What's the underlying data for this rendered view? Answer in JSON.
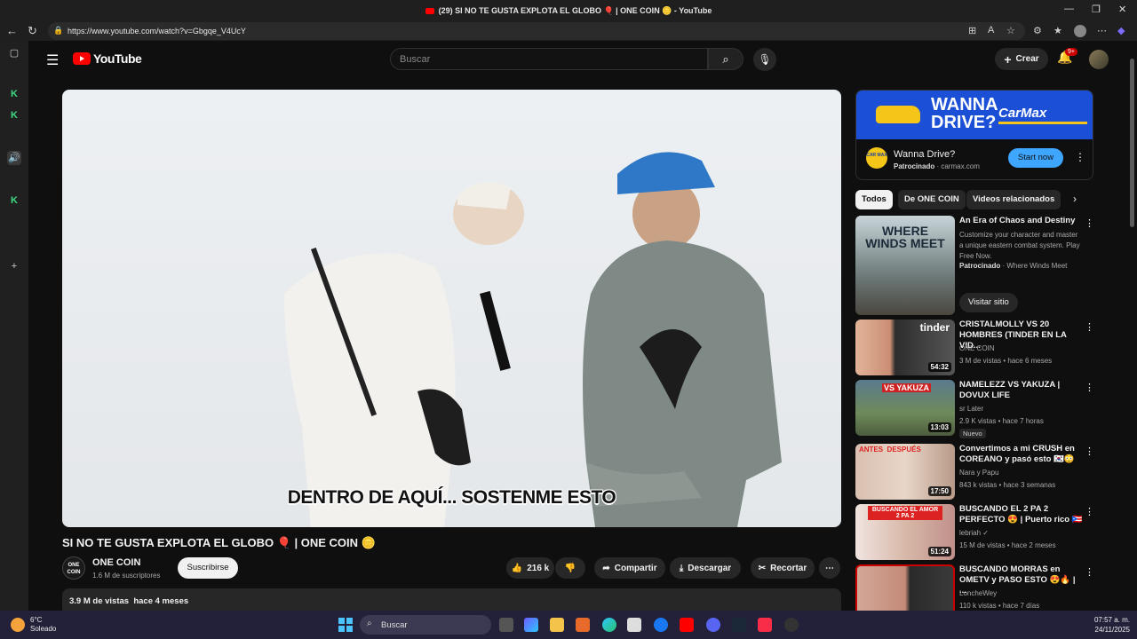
{
  "browser": {
    "window_title": "(29) SI NO TE GUSTA EXPLOTA EL GLOBO 🎈 | ONE COIN 🪙 - YouTube",
    "url": "https://www.youtube.com/watch?v=Gbgqe_V4UcY"
  },
  "youtube": {
    "logo_text": "YouTube",
    "search_placeholder": "Buscar",
    "create_label": "Crear",
    "notif_count": "9+"
  },
  "video": {
    "subtitle": "DENTRO DE AQUÍ... SOSTENME ESTO",
    "title": "SI NO TE GUSTA EXPLOTA EL GLOBO 🎈 | ONE COIN 🪙",
    "channel_avatar_text": "ONE COIN",
    "channel": "ONE COIN",
    "subscribers": "1.6 M de suscriptores",
    "subscribe_label": "Suscribirse",
    "likes": "216 k",
    "share_label": "Compartir",
    "download_label": "Descargar",
    "clip_label": "Recortar",
    "views_date": "3.9 M de vistas  hace 4 meses"
  },
  "ad": {
    "banner_headline": "WANNA DRIVE?",
    "banner_brand": "CarMax",
    "logo_text": "CAR MAX",
    "title": "Wanna Drive?",
    "sponsored": "Patrocinado",
    "domain": "carmax.com",
    "cta": "Start now"
  },
  "chips": [
    "Todos",
    "De ONE COIN",
    "Videos relacionados"
  ],
  "recommendations": [
    {
      "title": "An Era of Chaos and Destiny",
      "desc": "Customize your character and master a unique eastern combat system. Play Free Now.",
      "sponsored": "Patrocinado",
      "advertiser": "Where Winds Meet",
      "cta": "Visitar sitio",
      "thumb_text": "WHERE WINDS MEET"
    },
    {
      "title": "CRISTALMOLLY VS 20 HOMBRES (TINDER EN LA VID...",
      "channel": "ONE COIN",
      "meta": "3 M de vistas • hace 6 meses",
      "duration": "54:32",
      "thumb_text": "tinder"
    },
    {
      "title": "NAMELEZZ VS YAKUZA | DOVUX LIFE",
      "channel": "sr Later",
      "meta": "2.9 K vistas • hace 7 horas",
      "duration": "13:03",
      "badge": "Nuevo",
      "thumb_text": "VS YAKUZA"
    },
    {
      "title": "Convertimos a mi CRUSH en COREANO y pasó esto 🇰🇷😳",
      "channel": "Nara y Papu",
      "meta": "843 k vistas • hace 3 semanas",
      "duration": "17:50",
      "thumb_text": "ANTES  DESPUÉS"
    },
    {
      "title": "BUSCANDO EL 2 PA 2 PERFECTO 😍 | Puerto rico 🇵🇷",
      "channel": "lebriah ✓",
      "meta": "15 M de vistas • hace 2 meses",
      "duration": "51:24",
      "thumb_text": "BUSCANDO EL AMOR 2 PA 2"
    },
    {
      "title": "BUSCANDO MORRAS en OMETV y PASO ESTO 😍🔥 | ...",
      "channel": "LoncheWey",
      "meta": "110 k vistas • hace 7 días"
    }
  ],
  "taskbar": {
    "temp": "6°C",
    "condition": "Soleado",
    "search_label": "Buscar",
    "time": "07:57 a. m.",
    "date": "24/11/2025"
  },
  "colors": {
    "background": "#0f0f0f",
    "accent_red": "#ff0000",
    "ad_blue": "#1a4fd6",
    "cta_blue": "#3ea6ff"
  }
}
